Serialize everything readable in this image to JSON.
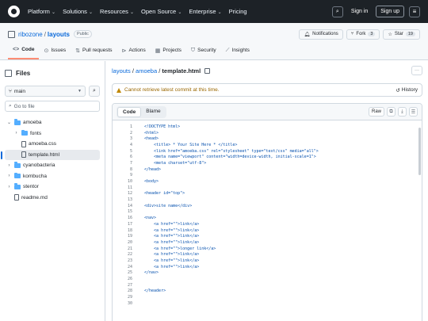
{
  "nav": {
    "items": [
      "Platform",
      "Solutions",
      "Resources",
      "Open Source",
      "Enterprise",
      "Pricing"
    ],
    "signin": "Sign in",
    "signup": "Sign up"
  },
  "repo": {
    "owner": "ribozone",
    "name": "layouts",
    "visibility": "Public",
    "notifications": "Notifications",
    "fork_label": "Fork",
    "fork_count": "3",
    "star_label": "Star",
    "star_count": "19"
  },
  "tabs": [
    "Code",
    "Issues",
    "Pull requests",
    "Actions",
    "Projects",
    "Security",
    "Insights"
  ],
  "sidebar": {
    "title": "Files",
    "branch": "main",
    "goto_placeholder": "Go to file",
    "tree": [
      {
        "label": "amoeba",
        "type": "folder-open",
        "depth": 0
      },
      {
        "label": "fonts",
        "type": "folder",
        "depth": 1
      },
      {
        "label": "amoeba.css",
        "type": "file",
        "depth": 1
      },
      {
        "label": "template.html",
        "type": "file",
        "depth": 1,
        "selected": true
      },
      {
        "label": "cyanobacteria",
        "type": "folder",
        "depth": 0
      },
      {
        "label": "kombucha",
        "type": "folder",
        "depth": 0
      },
      {
        "label": "stentor",
        "type": "folder",
        "depth": 0
      },
      {
        "label": "readme.md",
        "type": "file",
        "depth": 0
      }
    ]
  },
  "breadcrumb": {
    "repo": "layouts",
    "folder": "amoeba",
    "file": "template.html"
  },
  "warning": {
    "text": "Cannot retrieve latest commit at this time.",
    "history": "History"
  },
  "code_view": {
    "tab_code": "Code",
    "tab_blame": "Blame",
    "raw": "Raw",
    "lines": [
      "<!DOCTYPE html>",
      "<html>",
      "<head>",
      "    <title> * Your Site Here * </title>",
      "    <link href=\"amoeba.css\" rel=\"stylesheet\" type=\"text/css\" media=\"all\">",
      "    <meta name=\"viewport\" content=\"width=device-width, initial-scale=1\">",
      "    <meta charset=\"utf-8\">",
      "</head>",
      "",
      "<body>",
      "",
      "<header id=\"top\">",
      "",
      "<div>site name</div>",
      "",
      "<nav>",
      "    <a href=\"\">link</a>",
      "    <a href=\"\">link</a>",
      "    <a href=\"\">link</a>",
      "    <a href=\"\">link</a>",
      "    <a href=\"\">longer link</a>",
      "    <a href=\"\">link</a>",
      "    <a href=\"\">link</a>",
      "    <a href=\"\">link</a>",
      "</nav>",
      "",
      "",
      "</header>",
      "",
      ""
    ]
  }
}
